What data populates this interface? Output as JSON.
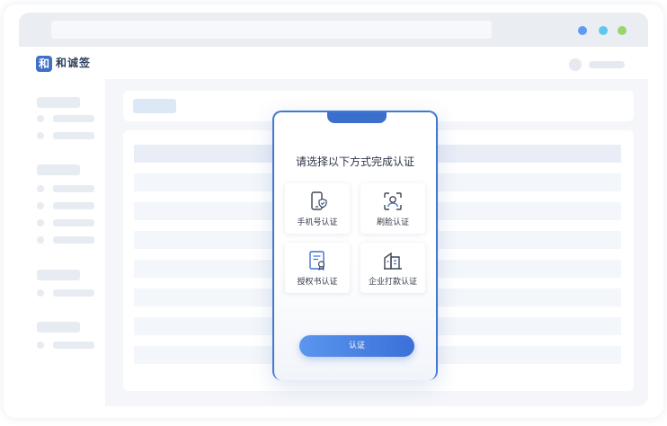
{
  "app": {
    "logo_mark": "和",
    "name": "和诚签"
  },
  "modal": {
    "title": "请选择以下方式完成认证",
    "options": [
      {
        "label": "手机号认证",
        "icon": "phone-shield-icon"
      },
      {
        "label": "刷脸认证",
        "icon": "face-scan-icon"
      },
      {
        "label": "授权书认证",
        "icon": "certificate-icon"
      },
      {
        "label": "企业打款认证",
        "icon": "building-icon"
      }
    ],
    "confirm_label": "认证"
  },
  "colors": {
    "accent": "#3b70d8",
    "dot_blue": "#5d9bf7",
    "dot_cyan": "#5cc8f0",
    "dot_green": "#9bd56a"
  }
}
